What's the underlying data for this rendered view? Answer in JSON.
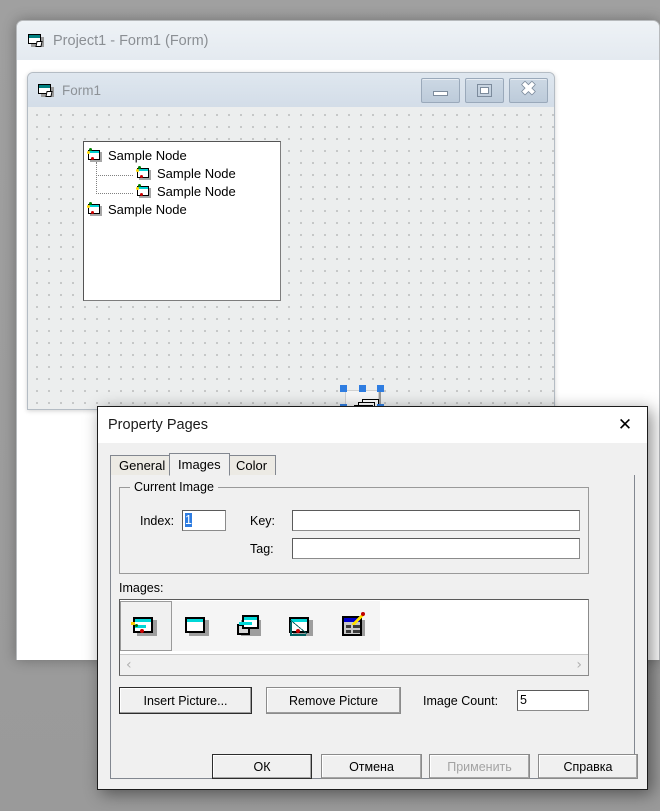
{
  "ide": {
    "title": "Project1 - Form1 (Form)",
    "icon": "vb-form-icon"
  },
  "form_window": {
    "title": "Form1",
    "icon": "vb-form-icon",
    "caption_buttons": [
      {
        "name": "minimize",
        "glyph": "minimize-icon"
      },
      {
        "name": "maximize",
        "glyph": "maximize-icon"
      },
      {
        "name": "close",
        "glyph": "close-icon"
      }
    ],
    "treeview": {
      "nodes": [
        {
          "label": "Sample Node",
          "level": 0
        },
        {
          "label": "Sample Node",
          "level": 1
        },
        {
          "label": "Sample Node",
          "level": 1
        },
        {
          "label": "Sample Node",
          "level": 0
        }
      ]
    },
    "imagelist_control": {
      "name": "ImageList1",
      "selected": true
    }
  },
  "dialog": {
    "title": "Property Pages",
    "close_label": "✕",
    "tabs": [
      {
        "label": "General",
        "active": false
      },
      {
        "label": "Images",
        "active": true
      },
      {
        "label": "Color",
        "active": false
      }
    ],
    "current_image": {
      "group_title": "Current Image",
      "index_label": "Index:",
      "index_value": "1",
      "key_label": "Key:",
      "key_value": "",
      "tag_label": "Tag:",
      "tag_value": ""
    },
    "images": {
      "label": "Images:",
      "items": [
        {
          "name": "image-1",
          "icon": "form-with-pins-icon",
          "selected": true
        },
        {
          "name": "image-2",
          "icon": "window-icon",
          "selected": false
        },
        {
          "name": "image-3",
          "icon": "two-windows-icon",
          "selected": false
        },
        {
          "name": "image-4",
          "icon": "window-ruler-icon",
          "selected": false
        },
        {
          "name": "image-5",
          "icon": "grid-pencil-icon",
          "selected": false
        }
      ],
      "scroll_left": "‹",
      "scroll_right": "›"
    },
    "actions": {
      "insert_picture": "Insert Picture...",
      "remove_picture": "Remove Picture",
      "image_count_label": "Image Count:",
      "image_count_value": "5"
    },
    "footer": [
      {
        "label": "ОК",
        "name": "ok",
        "state": "default"
      },
      {
        "label": "Отмена",
        "name": "cancel",
        "state": "normal"
      },
      {
        "label": "Применить",
        "name": "apply",
        "state": "disabled"
      },
      {
        "label": "Справка",
        "name": "help",
        "state": "normal"
      }
    ]
  },
  "colors": {
    "accent": "#2f7de1",
    "dialog_bg": "#f0f0f0",
    "titlebar": "#e4eaf0",
    "form_bg": "#eceeee"
  }
}
